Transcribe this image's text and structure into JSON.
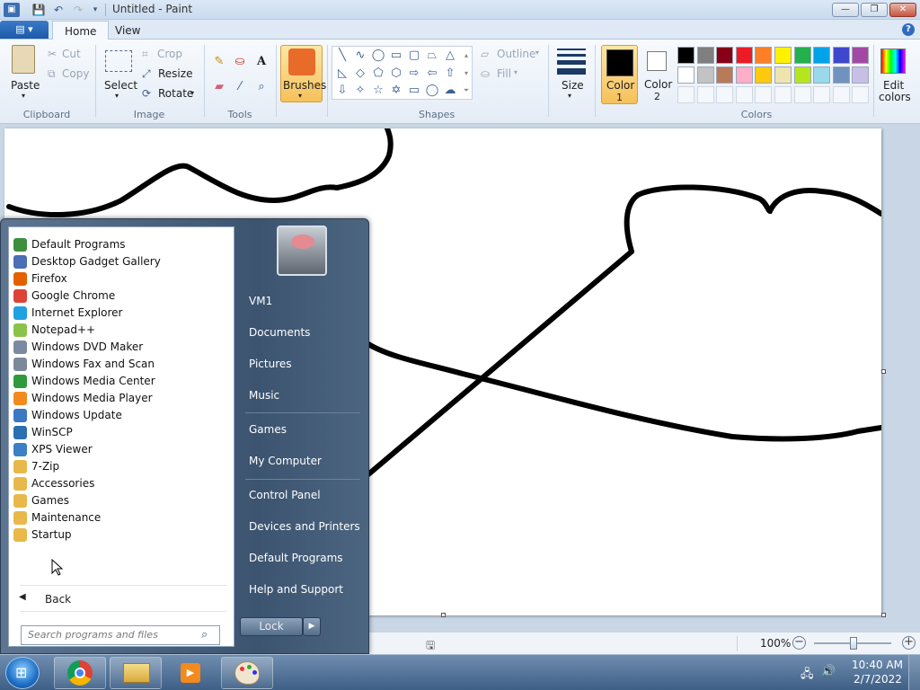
{
  "window": {
    "title": "Untitled - Paint",
    "minimize_label": "—",
    "maximize_label": "❐",
    "close_label": "✕"
  },
  "ribbon": {
    "tabs": [
      "Home",
      "View"
    ],
    "clipboard": {
      "paste": "Paste",
      "cut": "Cut",
      "copy": "Copy",
      "group": "Clipboard"
    },
    "image": {
      "select": "Select",
      "crop": "Crop",
      "resize": "Resize",
      "rotate": "Rotate",
      "group": "Image"
    },
    "tools_group": "Tools",
    "brushes": "Brushes",
    "shapes": {
      "outline": "Outline",
      "fill": "Fill",
      "group": "Shapes"
    },
    "size": "Size",
    "color1": {
      "label": "Color",
      "num": "1",
      "value": "#000000"
    },
    "color2": {
      "label": "Color",
      "num": "2",
      "value": "#ffffff"
    },
    "colors_group": "Colors",
    "edit_colors": {
      "line1": "Edit",
      "line2": "colors"
    },
    "palette_row1": [
      "#000000",
      "#7f7f7f",
      "#880015",
      "#ed1c24",
      "#ff7f27",
      "#fff200",
      "#22b14c",
      "#00a2e8",
      "#3f48cc",
      "#a349a4"
    ],
    "palette_row2": [
      "#ffffff",
      "#c3c3c3",
      "#b97a57",
      "#ffaec9",
      "#ffc90e",
      "#efe4b0",
      "#b5e61d",
      "#99d9ea",
      "#7092be",
      "#c8bfe7"
    ]
  },
  "status": {
    "zoom": "100%"
  },
  "start_menu": {
    "programs": [
      {
        "label": "Default Programs",
        "color": "#3d8f3d"
      },
      {
        "label": "Desktop Gadget Gallery",
        "color": "#4a6fb5"
      },
      {
        "label": "Firefox",
        "color": "#e66000"
      },
      {
        "label": "Google Chrome",
        "color": "#db4437"
      },
      {
        "label": "Internet Explorer",
        "color": "#1ea1e1"
      },
      {
        "label": "Notepad++",
        "color": "#8bc34a"
      },
      {
        "label": "Windows DVD Maker",
        "color": "#7a8aa0"
      },
      {
        "label": "Windows Fax and Scan",
        "color": "#7b8a99"
      },
      {
        "label": "Windows Media Center",
        "color": "#2e9a3c"
      },
      {
        "label": "Windows Media Player",
        "color": "#f28a1d"
      },
      {
        "label": "Windows Update",
        "color": "#3a78c4"
      },
      {
        "label": "WinSCP",
        "color": "#2a6fb0"
      },
      {
        "label": "XPS Viewer",
        "color": "#3b7fc4"
      },
      {
        "label": "7-Zip",
        "color": "#e8b94a"
      },
      {
        "label": "Accessories",
        "color": "#e8b94a"
      },
      {
        "label": "Games",
        "color": "#e8b94a"
      },
      {
        "label": "Maintenance",
        "color": "#e8b94a"
      },
      {
        "label": "Startup",
        "color": "#e8b94a"
      }
    ],
    "back": "Back",
    "search_placeholder": "Search programs and files",
    "right_links": [
      "VM1",
      "Documents",
      "Pictures",
      "Music",
      "Games",
      "My Computer",
      "Control Panel",
      "Devices and Printers",
      "Default Programs",
      "Help and Support"
    ],
    "lock": "Lock"
  },
  "taskbar": {
    "time": "10:40 AM",
    "date": "2/7/2022"
  }
}
